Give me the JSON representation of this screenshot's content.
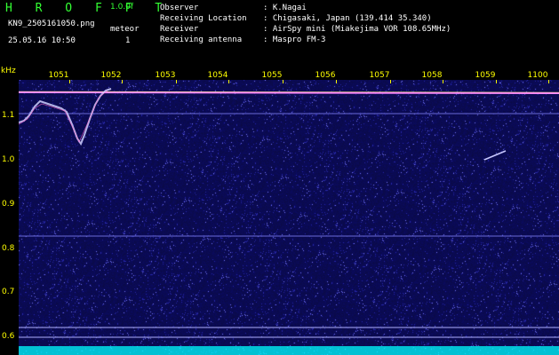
{
  "header": {
    "app_title": "H R O F F T",
    "version": "1.0.0f",
    "filename": "KN9_2505161050.png",
    "datetime": "25.05.16 10:50",
    "meteor_label": "meteor",
    "meteor_count": "1"
  },
  "info": {
    "labels": [
      "Observer",
      "Receiving Location",
      "Receiver",
      "Receiving antenna"
    ],
    "values": [
      ": K.Nagai",
      ": Chigasaki, Japan (139.414 35.340)",
      ": AirSpy mini (Miakejima VOR 108.65MHz)",
      ": Maspro FM-3"
    ]
  },
  "axes": {
    "y_unit": "kHz",
    "x_ticks": [
      "1051",
      "1052",
      "1053",
      "1054",
      "1055",
      "1056",
      "1057",
      "1058",
      "1059",
      "1100"
    ],
    "y_ticks": [
      "1.1",
      "1.0",
      "0.9",
      "0.8",
      "0.7",
      "0.6"
    ]
  },
  "colors": {
    "background": "#000000",
    "axis": "#ffff00",
    "title": "#33ff33",
    "noise_base": "#0a0a4a",
    "carrier": "#ff88ff",
    "echo_trace": "#d0d0ff",
    "baseline": "#00ffff"
  }
}
